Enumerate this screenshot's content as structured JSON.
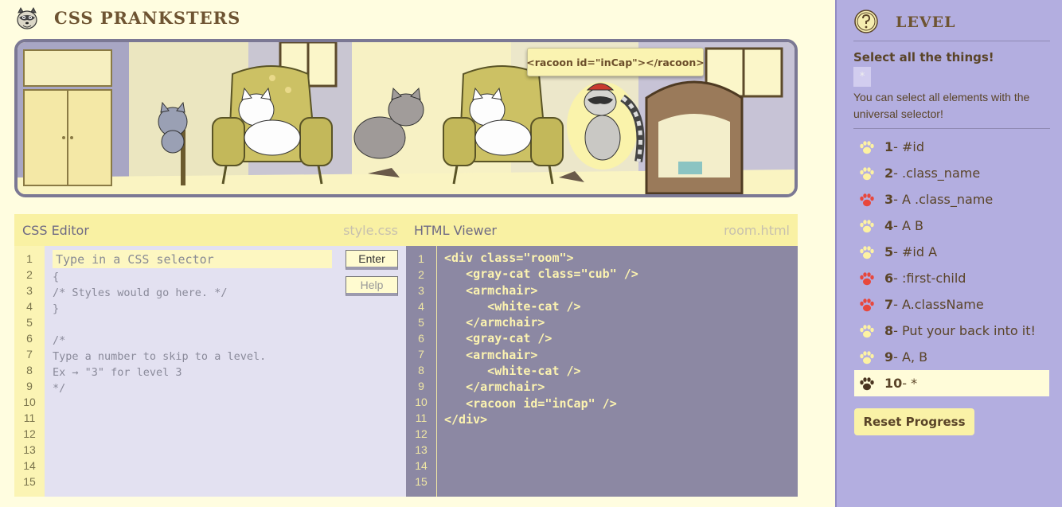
{
  "app": {
    "title": "CSS Pranksters"
  },
  "scene": {
    "tooltip": "<racoon id=\"inCap\"></racoon>"
  },
  "css_editor": {
    "title": "CSS Editor",
    "file": "style.css",
    "input_placeholder": "Type in a CSS selector",
    "enter_label": "Enter",
    "help_label": "Help",
    "line_numbers": [
      "1",
      "2",
      "3",
      "4",
      "5",
      "6",
      "7",
      "8",
      "9",
      "10",
      "11",
      "12",
      "13",
      "14",
      "15"
    ],
    "code": [
      "{",
      "/* Styles would go here. */",
      "}",
      "",
      "/*",
      "Type a number to skip to a level.",
      "Ex → \"3\" for level 3",
      "*/"
    ]
  },
  "html_viewer": {
    "title": "HTML Viewer",
    "file": "room.html",
    "line_numbers": [
      "1",
      "2",
      "3",
      "4",
      "5",
      "6",
      "7",
      "8",
      "9",
      "10",
      "11",
      "12",
      "13",
      "14",
      "15"
    ],
    "code": [
      "<div class=\"room\">",
      "   <gray-cat class=\"cub\" />",
      "   <armchair>",
      "      <white-cat />",
      "   </armchair>",
      "   <gray-cat />",
      "   <armchair>",
      "      <white-cat />",
      "   </armchair>",
      "   <racoon id=\"inCap\" />",
      "</div>"
    ]
  },
  "sidebar": {
    "title": "Level",
    "level_name": "Select all the things!",
    "syntax": "*",
    "hint": "You can select all elements with the universal selector!",
    "levels": [
      {
        "num": "1",
        "label": " - #id",
        "status": "done",
        "paw_color": "#fdf2a2"
      },
      {
        "num": "2",
        "label": " - .class_name",
        "status": "done",
        "paw_color": "#fdf2a2"
      },
      {
        "num": "3",
        "label": " - A .class_name",
        "status": "skipped",
        "paw_color": "#e8473c"
      },
      {
        "num": "4",
        "label": " - A B",
        "status": "done",
        "paw_color": "#fdf2a2"
      },
      {
        "num": "5",
        "label": " - #id A",
        "status": "done",
        "paw_color": "#fdf2a2"
      },
      {
        "num": "6",
        "label": " - :first-child",
        "status": "skipped",
        "paw_color": "#e8473c"
      },
      {
        "num": "7",
        "label": " - A.className",
        "status": "skipped",
        "paw_color": "#e8473c"
      },
      {
        "num": "8",
        "label": " - Put your back into it!",
        "status": "done",
        "paw_color": "#fdf2a2"
      },
      {
        "num": "9",
        "label": " - A, B",
        "status": "done",
        "paw_color": "#fdf2a2"
      },
      {
        "num": "10",
        "label": " - *",
        "status": "current",
        "paw_color": "#4a3520"
      }
    ],
    "reset_label": "Reset Progress"
  }
}
